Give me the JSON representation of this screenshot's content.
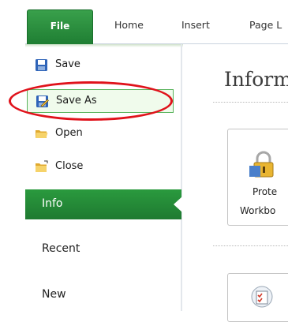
{
  "ribbon": {
    "tabs": [
      "File",
      "Home",
      "Insert",
      "Page L"
    ]
  },
  "backstage": {
    "commands": [
      {
        "label": "Save",
        "icon": "save-icon"
      },
      {
        "label": "Save As",
        "icon": "save-as-icon"
      },
      {
        "label": "Open",
        "icon": "open-folder-icon"
      },
      {
        "label": "Close",
        "icon": "close-folder-icon"
      }
    ],
    "nav": [
      {
        "label": "Info",
        "selected": true
      },
      {
        "label": "Recent"
      },
      {
        "label": "New"
      }
    ]
  },
  "main": {
    "heading": "Inform",
    "protect": {
      "line1": "Prote",
      "line2": "Workbo",
      "icon": "lock-icon"
    },
    "lower_icon": "checklist-icon"
  },
  "colors": {
    "file_tab": "#2a9a3e",
    "selected_nav": "#2a9a3e",
    "saveas_border": "#58b35b",
    "highlight": "#e0121b"
  }
}
